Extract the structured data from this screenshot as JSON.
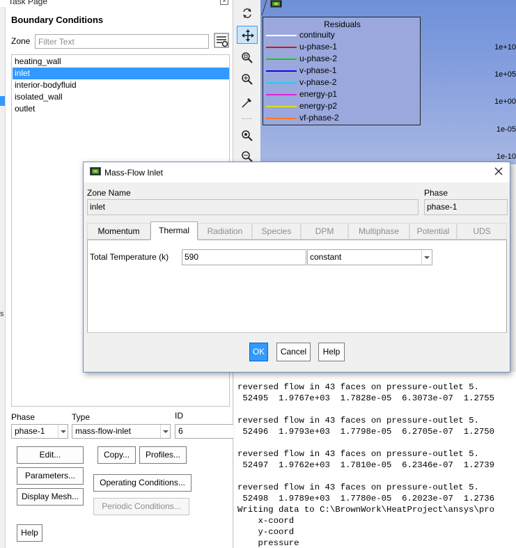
{
  "task_page": {
    "title": "Task Page",
    "side_fragment": "s",
    "panel_title": "Boundary Conditions",
    "zone_label": "Zone",
    "filter_placeholder": "Filter Text",
    "zones": [
      "heating_wall",
      "inlet",
      "interior-bodyfluid",
      "isolated_wall",
      "outlet"
    ],
    "selected_zone": "inlet",
    "phase_label": "Phase",
    "phase_value": "phase-1",
    "type_label": "Type",
    "type_value": "mass-flow-inlet",
    "id_label": "ID",
    "id_value": "6",
    "buttons": {
      "edit": "Edit...",
      "copy": "Copy...",
      "profiles": "Profiles...",
      "parameters": "Parameters...",
      "operating_conditions": "Operating Conditions...",
      "display_mesh": "Display Mesh...",
      "periodic_conditions": "Periodic Conditions...",
      "help": "Help"
    }
  },
  "toolbar": {
    "tools": [
      "rotate-icon",
      "pan-icon",
      "zoom-fit-icon",
      "zoom-in-icon",
      "probe-icon",
      "zoom-box-icon",
      "zoom-out-icon"
    ],
    "active_tool": "pan-icon"
  },
  "graphics": {
    "legend_title": "Residuals",
    "legend": [
      {
        "name": "continuity",
        "color": "#ffffff"
      },
      {
        "name": "u-phase-1",
        "color": "#dd1111"
      },
      {
        "name": "u-phase-2",
        "color": "#11cc11"
      },
      {
        "name": "v-phase-1",
        "color": "#0a0adc"
      },
      {
        "name": "v-phase-2",
        "color": "#22ccee"
      },
      {
        "name": "energy-p1",
        "color": "#dd22dd"
      },
      {
        "name": "energy-p2",
        "color": "#dddd22"
      },
      {
        "name": "vf-phase-2",
        "color": "#ff7722"
      }
    ],
    "y_ticks": [
      "1e+10",
      "1e+05",
      "1e+00",
      "1e-05",
      "1e-10"
    ]
  },
  "console": {
    "lines": [
      "reversed flow in 43 faces on pressure-outlet 5.",
      " 52495  1.9767e+03  1.7828e-05  6.3073e-07  1.2755",
      "",
      "reversed flow in 43 faces on pressure-outlet 5.",
      " 52496  1.9793e+03  1.7798e-05  6.2705e-07  1.2750",
      "",
      "reversed flow in 43 faces on pressure-outlet 5.",
      " 52497  1.9762e+03  1.7810e-05  6.2346e-07  1.2739",
      "",
      "reversed flow in 43 faces on pressure-outlet 5.",
      " 52498  1.9789e+03  1.7780e-05  6.2023e-07  1.2736",
      "Writing data to C:\\BrownWork\\HeatProject\\ansys\\pro",
      "    x-coord",
      "    y-coord",
      "    pressure"
    ]
  },
  "dialog": {
    "title": "Mass-Flow Inlet",
    "zone_name_label": "Zone Name",
    "zone_name": "inlet",
    "phase_label": "Phase",
    "phase": "phase-1",
    "tabs": [
      "Momentum",
      "Thermal",
      "Radiation",
      "Species",
      "DPM",
      "Multiphase",
      "Potential",
      "UDS"
    ],
    "active_tab": "Thermal",
    "total_temperature_label": "Total Temperature (k)",
    "total_temperature_value": "590",
    "total_temperature_method": "constant",
    "buttons": {
      "ok": "OK",
      "cancel": "Cancel",
      "help": "Help"
    }
  }
}
